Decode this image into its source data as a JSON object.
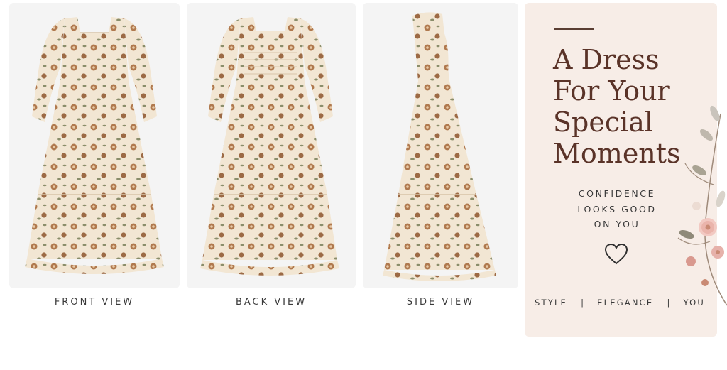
{
  "views": [
    {
      "label": "FRONT VIEW",
      "image": "floral maxi dress front view photo"
    },
    {
      "label": "BACK VIEW",
      "image": "floral maxi dress back view photo"
    },
    {
      "label": "SIDE VIEW",
      "image": "floral maxi dress side view photo"
    }
  ],
  "promo": {
    "headline": [
      "A Dress",
      "For Your",
      "Special",
      "Moments"
    ],
    "tagline": [
      "CONFIDENCE",
      "LOOKS GOOD",
      "ON YOU"
    ],
    "heart_icon": "heart-icon",
    "footer": [
      "STYLE",
      "|",
      "ELEGANCE",
      "|",
      "YOU"
    ]
  },
  "colors": {
    "background": "#ffffff",
    "photo_bg": "#f4f4f4",
    "promo_bg": "#f7ede7",
    "headline": "#5a3328",
    "text": "#3a3a3a",
    "fabric": "#f2e6d3",
    "flower": "#b0794e",
    "leaf": "#8a8d6a"
  }
}
